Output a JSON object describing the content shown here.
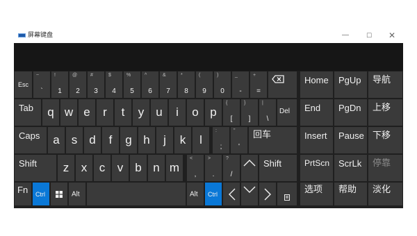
{
  "window": {
    "title": "屏幕键盘",
    "controls": {
      "minimize": "—",
      "maximize": "☐",
      "close": "✕"
    }
  },
  "keys": {
    "esc": "Esc",
    "num": [
      {
        "shift": "~",
        "base": "`"
      },
      {
        "shift": "!",
        "base": "1"
      },
      {
        "shift": "@",
        "base": "2"
      },
      {
        "shift": "#",
        "base": "3"
      },
      {
        "shift": "$",
        "base": "4"
      },
      {
        "shift": "%",
        "base": "5"
      },
      {
        "shift": "^",
        "base": "6"
      },
      {
        "shift": "&",
        "base": "7"
      },
      {
        "shift": "*",
        "base": "8"
      },
      {
        "shift": "(",
        "base": "9"
      },
      {
        "shift": ")",
        "base": "0"
      },
      {
        "shift": "_",
        "base": "-"
      },
      {
        "shift": "+",
        "base": "="
      }
    ],
    "tab": "Tab",
    "row_q": [
      "q",
      "w",
      "e",
      "r",
      "t",
      "y",
      "u",
      "i",
      "o",
      "p"
    ],
    "brackets": [
      {
        "shift": "{",
        "base": "["
      },
      {
        "shift": "}",
        "base": "]"
      },
      {
        "shift": "|",
        "base": "\\"
      }
    ],
    "del": "Del",
    "caps": "Caps",
    "row_a": [
      "a",
      "s",
      "d",
      "f",
      "g",
      "h",
      "j",
      "k",
      "l"
    ],
    "semi": [
      {
        "shift": ":",
        "base": ";"
      },
      {
        "shift": "\"",
        "base": "'"
      }
    ],
    "enter": "回车",
    "shift": "Shift",
    "row_z": [
      "z",
      "x",
      "c",
      "v",
      "b",
      "n",
      "m"
    ],
    "punct": [
      {
        "shift": "<",
        "base": ","
      },
      {
        "shift": ">",
        "base": "."
      },
      {
        "shift": "?",
        "base": "/"
      }
    ],
    "fn": "Fn",
    "ctrl": "Ctrl",
    "alt": "Alt",
    "nav": {
      "home": "Home",
      "pgup": "PgUp",
      "nav": "导航",
      "end": "End",
      "pgdn": "PgDn",
      "up_move": "上移",
      "insert": "Insert",
      "pause": "Pause",
      "down_move": "下移",
      "prtscn": "PrtScn",
      "scrlk": "ScrLk",
      "dock": "停靠",
      "options": "选项",
      "help": "帮助",
      "fade": "淡化"
    }
  },
  "colors": {
    "key": "#3a3a3a",
    "active": "#0a78d7",
    "background": "#1f1f1f"
  },
  "icons": [
    "backspace-icon",
    "windows-logo-icon",
    "arrow-up-icon",
    "arrow-left-icon",
    "arrow-down-icon",
    "arrow-right-icon",
    "menu-key-icon"
  ]
}
